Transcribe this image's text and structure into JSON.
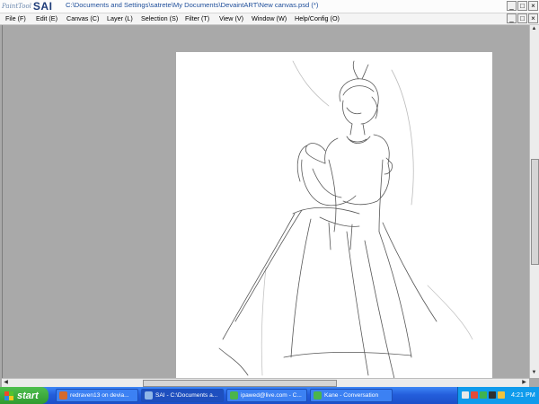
{
  "app": {
    "logo_prefix": "PaintTool",
    "logo_name": "SAI",
    "document_path": "C:\\Documents and Settings\\satrete\\My Documents\\DevaintART\\New canvas.psd (*)"
  },
  "window_controls": {
    "minimize": "_",
    "maximize": "□",
    "close": "×"
  },
  "menu": {
    "items": [
      {
        "label": "File (F)"
      },
      {
        "label": "Edit (E)"
      },
      {
        "label": "Canvas (C)"
      },
      {
        "label": "Layer (L)"
      },
      {
        "label": "Selection (S)"
      },
      {
        "label": "Filter (T)"
      },
      {
        "label": "View (V)"
      },
      {
        "label": "Window (W)"
      },
      {
        "label": "Help/Config (O)"
      }
    ]
  },
  "scrollbars": {
    "vertical_arrow_up": "▲",
    "vertical_arrow_down": "▼",
    "horizontal_arrow_left": "◀",
    "horizontal_arrow_right": "▶"
  },
  "taskbar": {
    "start_label": "start",
    "tasks": [
      {
        "label": "redraven13 on devia...",
        "icon": "browser-icon",
        "color": "#d46a2c"
      },
      {
        "label": "SAI - C:\\Documents a...",
        "icon": "sai-icon",
        "color": "#8fb6e8"
      },
      {
        "label": "ipawed@live.com - C...",
        "icon": "messenger-icon",
        "color": "#4bb54b"
      },
      {
        "label": "Kane - Conversation",
        "icon": "messenger-icon",
        "color": "#4bb54b"
      }
    ],
    "clock": "4:21 PM"
  }
}
